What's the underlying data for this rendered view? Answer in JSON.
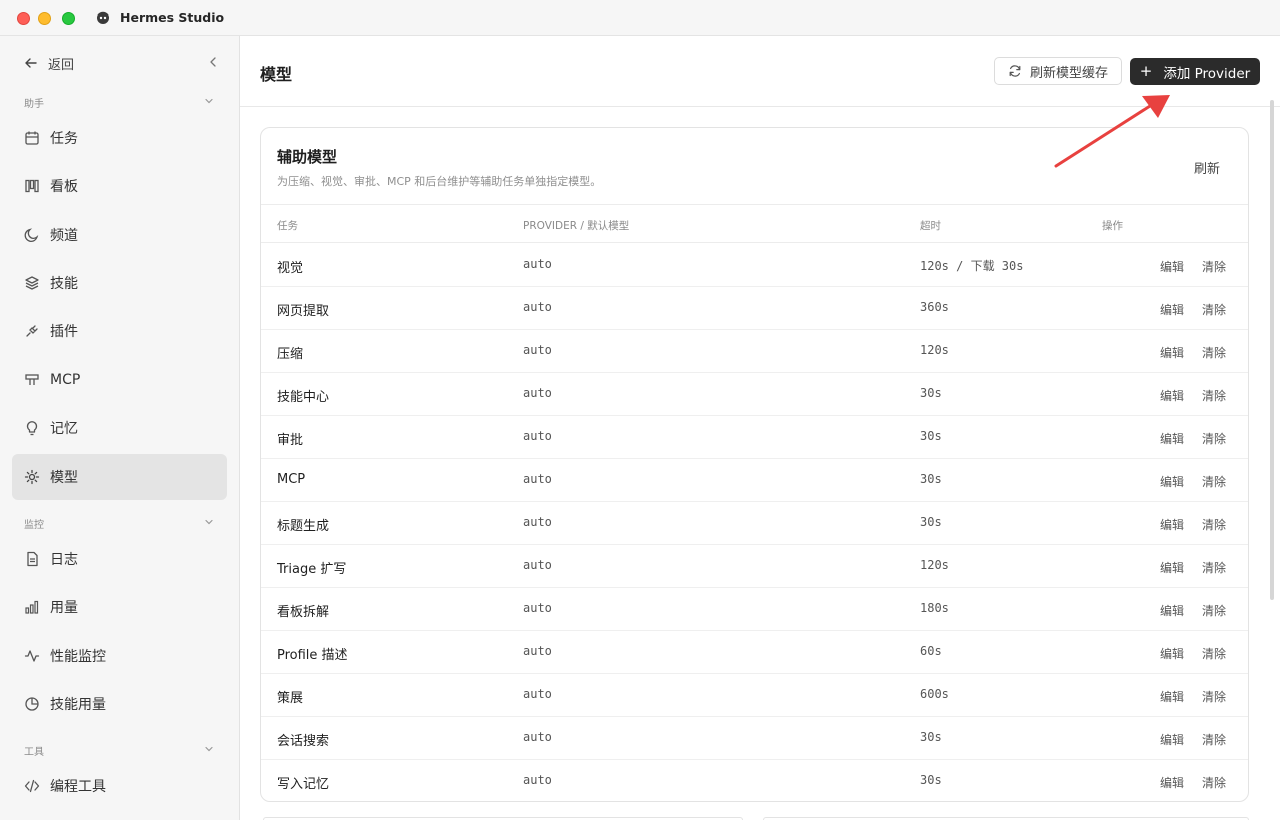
{
  "window": {
    "title": "Hermes Studio"
  },
  "sidebar": {
    "back_label": "返回",
    "groups": [
      {
        "label": "助手"
      },
      {
        "label": "监控"
      },
      {
        "label": "工具"
      }
    ],
    "items": [
      {
        "label": "任务",
        "icon": "calendar-icon",
        "active": false
      },
      {
        "label": "看板",
        "icon": "kanban-icon",
        "active": false
      },
      {
        "label": "频道",
        "icon": "moon-icon",
        "active": false
      },
      {
        "label": "技能",
        "icon": "layers-icon",
        "active": false
      },
      {
        "label": "插件",
        "icon": "plug-icon",
        "active": false
      },
      {
        "label": "MCP",
        "icon": "server-icon",
        "active": false
      },
      {
        "label": "记忆",
        "icon": "lightbulb-icon",
        "active": false
      },
      {
        "label": "模型",
        "icon": "sun-icon",
        "active": true
      },
      {
        "label": "日志",
        "icon": "file-text-icon",
        "active": false
      },
      {
        "label": "用量",
        "icon": "bar-chart-icon",
        "active": false
      },
      {
        "label": "性能监控",
        "icon": "activity-icon",
        "active": false
      },
      {
        "label": "技能用量",
        "icon": "pie-chart-icon",
        "active": false
      },
      {
        "label": "编程工具",
        "icon": "code-icon",
        "active": false
      }
    ]
  },
  "header": {
    "title": "模型",
    "refresh_cache_label": "刷新模型缓存",
    "add_provider_label": "添加 Provider"
  },
  "card": {
    "title": "辅助模型",
    "description": "为压缩、视觉、审批、MCP 和后台维护等辅助任务单独指定模型。",
    "refresh_label": "刷新",
    "columns": [
      "任务",
      "PROVIDER / 默认模型",
      "超时",
      "操作"
    ],
    "edit_label": "编辑",
    "clear_label": "清除",
    "rows": [
      {
        "task": "视觉",
        "provider": "auto",
        "timeout": "120s / 下载 30s"
      },
      {
        "task": "网页提取",
        "provider": "auto",
        "timeout": "360s"
      },
      {
        "task": "压缩",
        "provider": "auto",
        "timeout": "120s"
      },
      {
        "task": "技能中心",
        "provider": "auto",
        "timeout": "30s"
      },
      {
        "task": "审批",
        "provider": "auto",
        "timeout": "30s"
      },
      {
        "task": "MCP",
        "provider": "auto",
        "timeout": "30s"
      },
      {
        "task": "标题生成",
        "provider": "auto",
        "timeout": "30s"
      },
      {
        "task": "Triage 扩写",
        "provider": "auto",
        "timeout": "120s"
      },
      {
        "task": "看板拆解",
        "provider": "auto",
        "timeout": "180s"
      },
      {
        "task": "Profile 描述",
        "provider": "auto",
        "timeout": "60s"
      },
      {
        "task": "策展",
        "provider": "auto",
        "timeout": "600s"
      },
      {
        "task": "会话搜索",
        "provider": "auto",
        "timeout": "30s"
      },
      {
        "task": "写入记忆",
        "provider": "auto",
        "timeout": "30s"
      }
    ]
  },
  "colors": {
    "accent_dark": "#2b2b2b",
    "annotation_arrow": "#e8413f",
    "sidebar_bg": "#f6f6f6",
    "active_item_bg": "#e4e4e4"
  }
}
